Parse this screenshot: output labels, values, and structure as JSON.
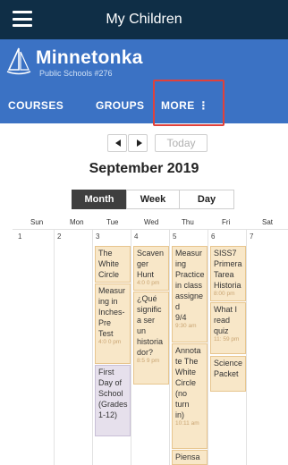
{
  "header": {
    "title": "My Children"
  },
  "brand": {
    "name": "Minnetonka",
    "subtitle": "Public Schools #276"
  },
  "nav": {
    "courses": "COURSES",
    "groups": "GROUPS",
    "more": "MORE ⋮"
  },
  "calendar_nav": {
    "prev_glyph": "◀",
    "next_glyph": "▶",
    "today": "Today"
  },
  "month_title": "September 2019",
  "views": {
    "month": "Month",
    "week": "Week",
    "day": "Day",
    "selected": "Month"
  },
  "weekdays": [
    "Sun",
    "Mon",
    "Tue",
    "Wed",
    "Thu",
    "Fri",
    "Sat"
  ],
  "day_numbers": [
    "1",
    "2",
    "3",
    "4",
    "5",
    "6",
    "7"
  ],
  "events": {
    "tue": [
      {
        "title": "The\nWhite\nCircle",
        "time": ""
      },
      {
        "title": "Measur\ning in\nInches-\nPre\nTest",
        "time": "4:0 0 pm"
      },
      {
        "title": "First\nDay of\nSchool\n(Grades\n1-12)",
        "time": ""
      }
    ],
    "wed": [
      {
        "title": "Scaven\nger\nHunt",
        "time": "4:0 0 pm"
      },
      {
        "title": "¿Qué\nsignific\na ser\nun\nhistoria\ndor?",
        "time": "8:5 9 pm"
      }
    ],
    "thu": [
      {
        "title": "Measur\ning\nPractice\nin class\nassigne\nd\n9/4",
        "time": "9:30 am"
      },
      {
        "title": "Annota\nte The\nWhite\nCircle\n(no\nturn\nin)",
        "time": "10:11 am"
      },
      {
        "title": "Piensa",
        "time": ""
      }
    ],
    "fri": [
      {
        "title": "SISS7\nPrimera\nTarea\nHistoria",
        "time": "8:00 pm"
      },
      {
        "title": "What I\nread\nquiz",
        "time": "11: 59 pm"
      },
      {
        "title": "Science\nPacket",
        "time": ""
      }
    ]
  },
  "colors": {
    "top_bar": "#0f2e46",
    "brand_bar": "#3b72c4",
    "highlight": "#e0413b",
    "event_bg": "#f8e7c8",
    "event_alt_bg": "#e6e0ec"
  },
  "icons": {
    "menu": "hamburger-icon",
    "logo": "sailboat-logo-icon",
    "more": "kebab-icon"
  }
}
